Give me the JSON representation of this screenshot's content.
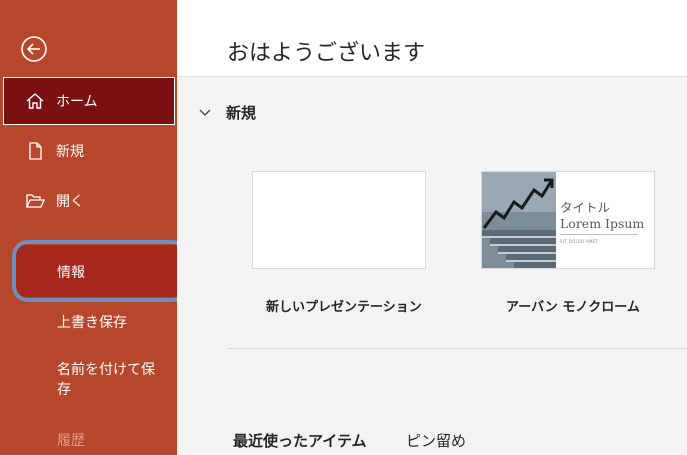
{
  "sidebar": {
    "home": "ホーム",
    "new": "新規",
    "open": "開く",
    "info": "情報",
    "save": "上書き保存",
    "save_as": "名前を付けて保存",
    "history": "履歴"
  },
  "main": {
    "greeting": "おはようございます",
    "new_section": {
      "title": "新規",
      "templates": [
        {
          "label": "新しいプレゼンテーション"
        },
        {
          "label": "アーバン モノクローム",
          "thumb_title": "タイトル",
          "thumb_title_2": "Lorem Ipsum",
          "thumb_sub": "SIT DOLOR AMET"
        }
      ]
    },
    "tabs": [
      "最近使ったアイテム",
      "ピン留め"
    ]
  },
  "colors": {
    "sidebar": "#b7472a",
    "home_selected": "#7b1013",
    "info_highlight": "#a6271b",
    "annotation_ring": "#6e8fc0",
    "content_bg": "#f3f3f3"
  }
}
